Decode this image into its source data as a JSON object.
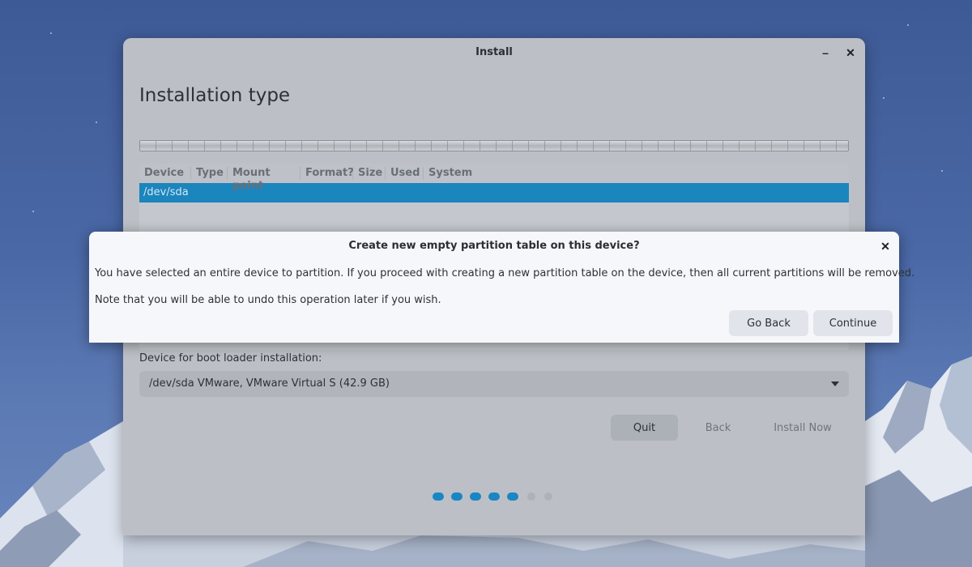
{
  "window": {
    "title": "Install",
    "minimize_glyph": "–",
    "close_glyph": "✕"
  },
  "page": {
    "title": "Installation type"
  },
  "partition_table": {
    "columns": [
      "Device",
      "Type",
      "Mount point",
      "Format?",
      "Size",
      "Used",
      "System"
    ],
    "rows": [
      {
        "device": "/dev/sda",
        "selected": true
      }
    ]
  },
  "bootloader": {
    "label": "Device for boot loader installation:",
    "selected_value": "/dev/sda VMware, VMware Virtual S (42.9 GB)"
  },
  "buttons": {
    "quit": "Quit",
    "back": "Back",
    "install_now": "Install Now"
  },
  "progress": {
    "total_steps": 7,
    "completed_steps": 5
  },
  "dialog": {
    "title": "Create new empty partition table on this device?",
    "message_1": "You have selected an entire device to partition. If you proceed with creating a new partition table on the device, then all current partitions will be removed.",
    "message_2": "Note that you will be able to undo this operation later if you wish.",
    "go_back": "Go Back",
    "continue": "Continue",
    "close_glyph": "✕"
  },
  "colors": {
    "accent": "#1b85bd",
    "window_dimmed": "#bcc0c6",
    "dialog_bg": "#f6f7fa"
  },
  "icons": {
    "window_close": "close-icon",
    "window_minimize": "minimize-icon",
    "dropdown": "chevron-down-icon"
  }
}
